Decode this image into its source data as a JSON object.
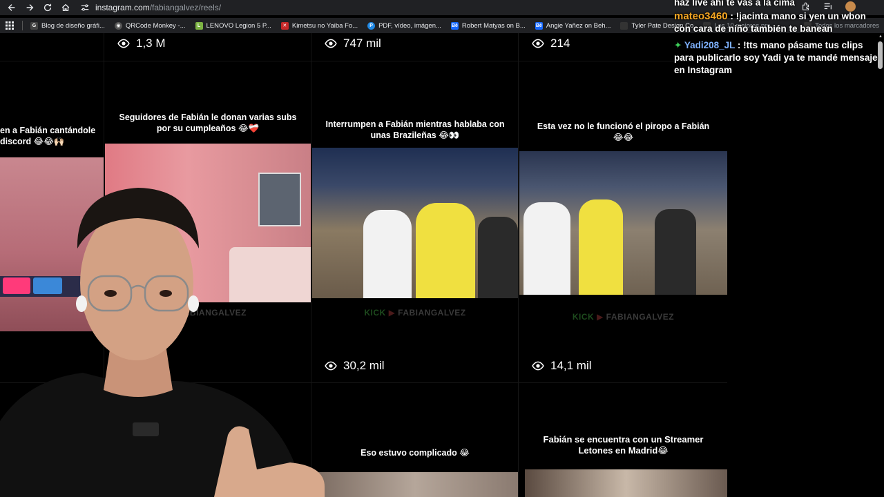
{
  "browser": {
    "url_host": "instagram.com",
    "url_path": "/fabiangalvez/reels/",
    "bookmarks": [
      {
        "label": "Blog de diseño gráfi...",
        "icon": "google-icon",
        "color": "#444444"
      },
      {
        "label": "QRCode Monkey -...",
        "icon": "qr-icon",
        "color": "#555555"
      },
      {
        "label": "LENOVO Legion 5 P...",
        "icon": "lenovo-icon",
        "color": "#7cb342"
      },
      {
        "label": "Kimetsu no Yaiba Fo...",
        "icon": "kimetsu-icon",
        "color": "#c62828"
      },
      {
        "label": "PDF, vídeo, imágen...",
        "icon": "pdf-icon",
        "color": "#1e88e5"
      },
      {
        "label": "Robert Matyas on B...",
        "icon": "behance-icon",
        "color": "#1769ff"
      },
      {
        "label": "Angie Yañez on Beh...",
        "icon": "behance-icon",
        "color": "#1769ff"
      },
      {
        "label": "Tyler Pate Design Co",
        "icon": "page-icon",
        "color": "#333333"
      },
      {
        "label": "Los 10 mejores pro...",
        "icon": "page-icon",
        "color": "#333333"
      },
      {
        "label": "Todos los marcadores",
        "icon": "folder-icon",
        "color": "#333333"
      }
    ]
  },
  "reels": {
    "row1": [
      {
        "views": "1,3 M"
      },
      {
        "views": "747 mil"
      },
      {
        "views": "214"
      }
    ],
    "row2": [
      {
        "caption": "en a Fabián cantándole discord 😂😂🙌🏻"
      },
      {
        "caption": "Seguidores de Fabián le donan varias subs por su cumpleaños 😂❤️‍🩹",
        "watermark": "FABIANGALVEZ"
      },
      {
        "caption": "Interrumpen a Fabián mientras hablaba con unas Brazileñas 😂👀",
        "watermark_kick": "KICK",
        "watermark": "FABIANGALVEZ",
        "views": "30,2 mil"
      },
      {
        "caption": "Esta vez no le funcionó el piropo a Fabián 😂😂",
        "watermark_kick": "KICK",
        "watermark": "FABIANGALVEZ",
        "views": "14,1 mil"
      }
    ],
    "row3": [
      {
        "caption": "Eso estuvo complicado 😂"
      },
      {
        "caption": "Fabián se encuentra con un Streamer Letones en Madrid😂"
      }
    ]
  },
  "chat": {
    "messages": [
      {
        "user": "",
        "text": "haz live ahí te vas a la cima"
      },
      {
        "user": "mateo3460",
        "user_color": "#f5a623",
        "text": ": !jacinta mano si yen un wbon con cara de niño también te banean"
      },
      {
        "user": "Yadi208_JL",
        "user_color": "#7fb2ff",
        "text": ": !tts mano pásame tus clips para publicarlo soy Yadi ya te mandé mensaje en Instagram"
      }
    ]
  }
}
